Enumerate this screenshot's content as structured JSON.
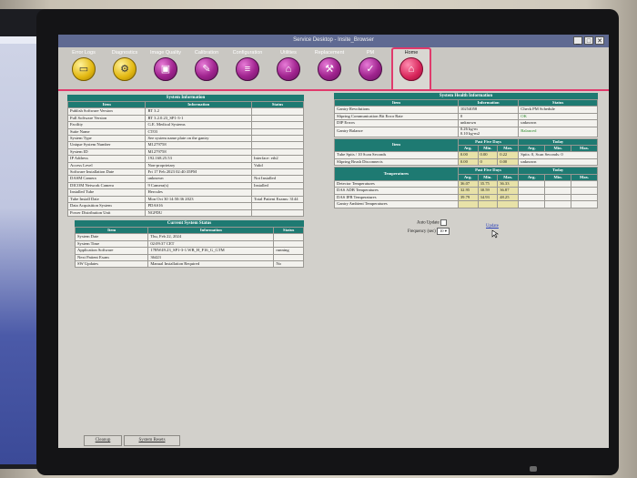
{
  "window": {
    "title": "Service Desktop - Insite_Browser",
    "min": "_",
    "max": "□",
    "close": "✕"
  },
  "toolbar": [
    {
      "label": "Error Logs",
      "icon": "error-logs-icon",
      "glyph": "▭",
      "color": "yellow"
    },
    {
      "label": "Diagnostics",
      "icon": "diagnostics-icon",
      "glyph": "⚙",
      "color": "yellow"
    },
    {
      "label": "Image Quality",
      "icon": "image-quality-icon",
      "glyph": "▣",
      "color": "magenta"
    },
    {
      "label": "Calibration",
      "icon": "calibration-icon",
      "glyph": "✎",
      "color": "magenta"
    },
    {
      "label": "Configuration",
      "icon": "configuration-icon",
      "glyph": "≡",
      "color": "magenta"
    },
    {
      "label": "Utilities",
      "icon": "utilities-icon",
      "glyph": "⌂",
      "color": "magenta"
    },
    {
      "label": "Replacement",
      "icon": "replacement-icon",
      "glyph": "⚒",
      "color": "magenta"
    },
    {
      "label": "PM",
      "icon": "pm-icon",
      "glyph": "✓",
      "color": "magenta"
    },
    {
      "label": "Home",
      "icon": "home-icon",
      "glyph": "⌂",
      "color": "home"
    }
  ],
  "system_information": {
    "title": "System Information",
    "headers": [
      "Item",
      "Information",
      "Status"
    ],
    "rows": [
      [
        "Publish Software Version",
        "RT 3.2",
        ""
      ],
      [
        "Full Software Version",
        "RT 3.2.0.23_SP1-3-1",
        ""
      ],
      [
        "Facility",
        "G.E. Medical Systems",
        ""
      ],
      [
        "Suite Name",
        "CT03",
        ""
      ],
      [
        "System Type",
        "See system name plate on the gantry",
        ""
      ],
      [
        "Unique System Number",
        "M1279758",
        ""
      ],
      [
        "System ID",
        "M1279758",
        ""
      ],
      [
        "IP Address",
        "192.168.25.53",
        "Interface: eth2"
      ],
      [
        "Access Level",
        "Non-proprietary",
        "Valid"
      ],
      [
        "Software Installation Date",
        "Fri 17 Feb 2023 02:40:35PM",
        ""
      ],
      [
        "DASM Camera",
        "unknown",
        "Not Installed"
      ],
      [
        "DICOM Network Camera",
        "9 Camera(s)",
        "Installed"
      ],
      [
        "Installed Tube",
        "Hercules",
        ""
      ],
      [
        "Tube Install Date",
        "Mon Oct 30 14:50:36 2023",
        "Total Patient Exams: 3144"
      ],
      [
        "Data Acquisition System",
        "PDAS16",
        ""
      ],
      [
        "Power Distribution Unit",
        "NGPDU",
        ""
      ]
    ]
  },
  "current_status": {
    "title": "Current System Status",
    "headers": [
      "Item",
      "Information",
      "Status"
    ],
    "rows": [
      [
        "System Date",
        "Thu, Feb 22, 2024",
        ""
      ],
      [
        "System Time",
        "02:09:37 CET",
        ""
      ],
      [
        "Application Software",
        "17BW49.23_SP1-3-1.WB_H_F16_G_GTM",
        "running"
      ],
      [
        "Next Patient Exam",
        "36423",
        ""
      ],
      [
        "SW Updates",
        "Manual Installation Required",
        "No"
      ]
    ]
  },
  "system_health": {
    "title": "System Health Information",
    "headers": [
      "Item",
      "Information",
      "Status"
    ],
    "rows": [
      [
        "Gantry Revolutions",
        "10254058",
        "Check PM Schedule"
      ],
      [
        "Slipring Communication Bit Error Rate",
        "0",
        "OK"
      ],
      [
        "DIP Errors",
        "unknown",
        "unknown"
      ],
      [
        "Gantry Balance",
        "0.26 kg-m\n0.10 kg-m2",
        "Balanced"
      ]
    ],
    "past_five_days": "Past Five Days",
    "today": "Today",
    "item_header": "Item",
    "sub_headers": [
      "Avg.",
      "Min.",
      "Max.",
      "Avg.",
      "Min.",
      "Max."
    ],
    "spits_rows": [
      [
        "Tube Spits / 10 Scan Seconds",
        "0.00",
        "0.00",
        "0.22",
        "Spits: 0, Scan Seconds: 0"
      ],
      [
        "Slipring Brush Disconnects",
        "0.00",
        "0",
        "0.00",
        "unknown"
      ]
    ],
    "temp_header": "Temperatures",
    "temp_rows": [
      [
        "Detector Temperatures",
        "36.07",
        "35.75",
        "36.33",
        "",
        "",
        ""
      ],
      [
        "DAS ADB Temperatures",
        "32.95",
        "30.59",
        "36.87",
        "",
        "",
        ""
      ],
      [
        "DAS IFB Temperatures",
        "39.79",
        "34.93",
        "48.25",
        "",
        "",
        ""
      ],
      [
        "Gantry Ambient Temperatures",
        "",
        "",
        "",
        "",
        "",
        ""
      ]
    ]
  },
  "controls": {
    "auto_update_label": "Auto Update",
    "frequency_label": "Frequency (sec)",
    "frequency_value": "10",
    "update_link": "Update"
  },
  "bottom_buttons": [
    "Cleanup",
    "System Resets"
  ]
}
